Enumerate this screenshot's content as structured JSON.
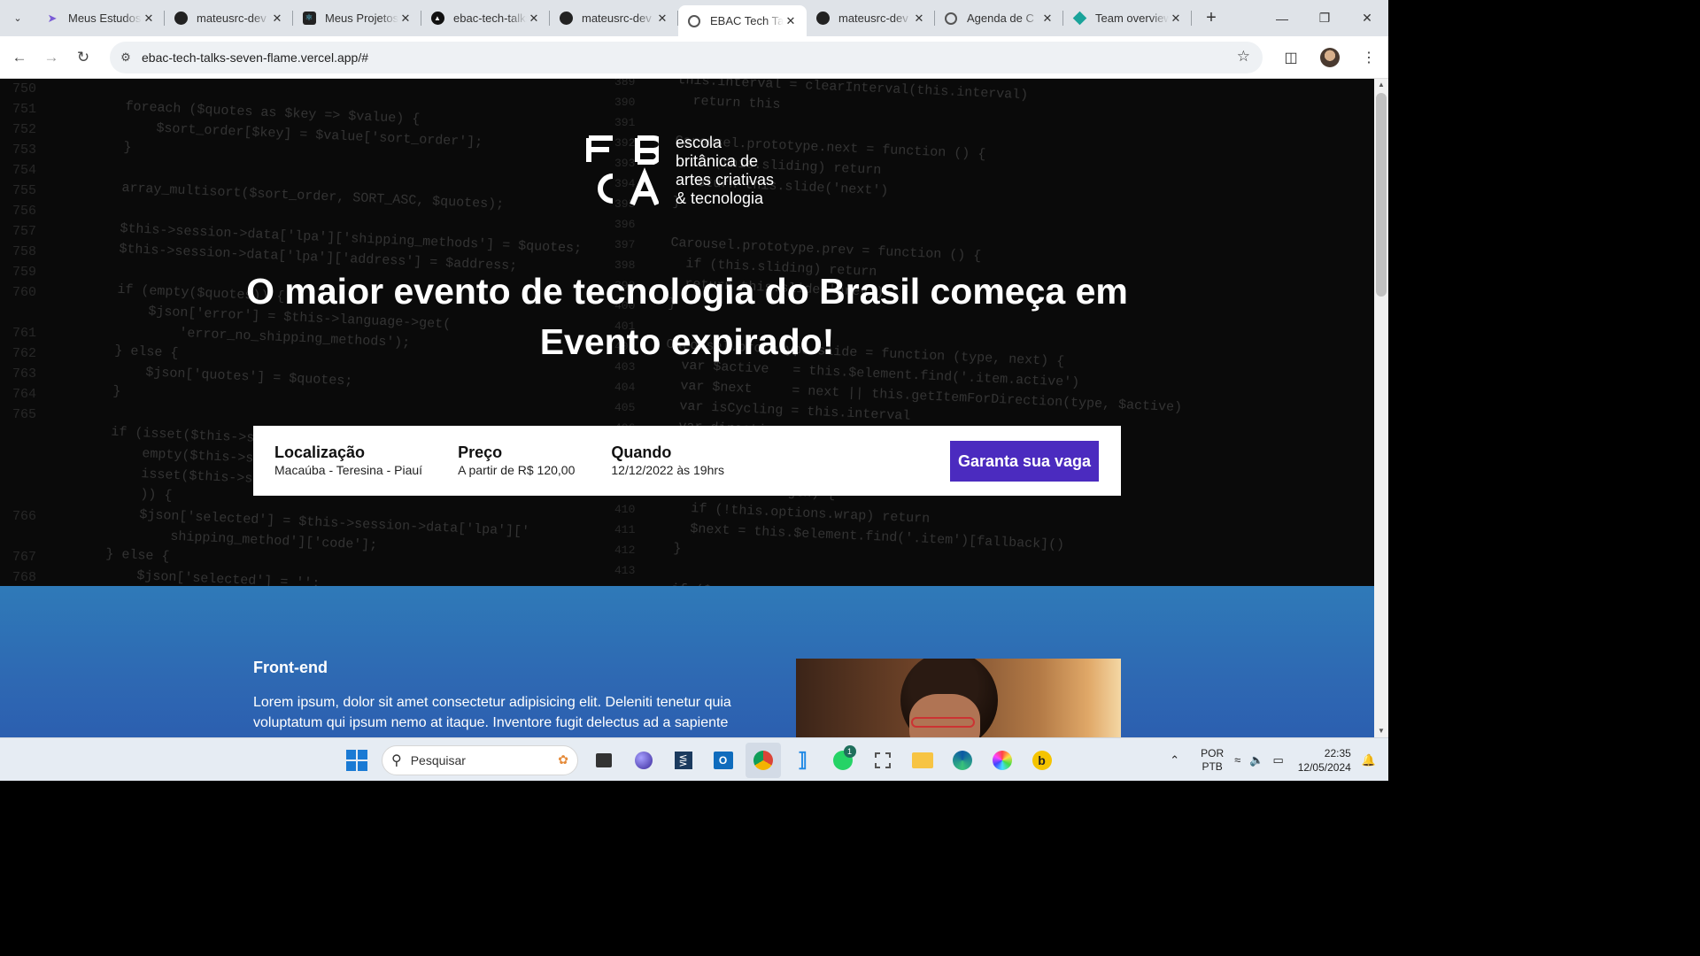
{
  "browser": {
    "tabs": [
      {
        "title": "Meus Estudos",
        "icon": "rocket-icon",
        "active": false
      },
      {
        "title": "mateusrc-dev",
        "icon": "github-icon",
        "active": false
      },
      {
        "title": "Meus Projetos",
        "icon": "react-icon",
        "active": false
      },
      {
        "title": "ebac-tech-talks",
        "icon": "vercel-icon",
        "active": false
      },
      {
        "title": "mateusrc-dev",
        "icon": "github-icon",
        "active": false
      },
      {
        "title": "EBAC Tech Talks",
        "icon": "globe-icon",
        "active": true
      },
      {
        "title": "mateusrc-dev",
        "icon": "github-icon",
        "active": false
      },
      {
        "title": "Agenda de C",
        "icon": "globe-icon",
        "active": false
      },
      {
        "title": "Team overview",
        "icon": "diamond-icon",
        "active": false
      }
    ],
    "url": "ebac-tech-talks-seven-flame.vercel.app/#"
  },
  "page": {
    "logo": {
      "line1": "escola",
      "line2": "britânica de",
      "line3": "artes criativas",
      "line4": "& tecnologia"
    },
    "headline_line1": "O maior evento de tecnologia do Brasil começa em",
    "headline_line2": "Evento expirado!",
    "info": {
      "location_title": "Localização",
      "location_value": "Macaúba - Teresina - Piauí",
      "price_title": "Preço",
      "price_value": "A partir de R$ 120,00",
      "when_title": "Quando",
      "when_value": "12/12/2022 às 19hrs",
      "cta_label": "Garanta sua vaga"
    },
    "section": {
      "title": "Front-end",
      "text": "Lorem ipsum, dolor sit amet consectetur adipisicing elit. Deleniti tenetur quia voluptatum qui ipsum nemo at itaque. Inventore fugit delectus ad a sapiente"
    }
  },
  "taskbar": {
    "search_placeholder": "Pesquisar",
    "lang_line1": "POR",
    "lang_line2": "PTB",
    "time": "22:35",
    "date": "12/05/2024",
    "whatsapp_badge": "1"
  },
  "colors": {
    "cta": "#4b2bbf",
    "section_blue": "#2e69b3",
    "hero_bg": "#0a0a0a"
  }
}
